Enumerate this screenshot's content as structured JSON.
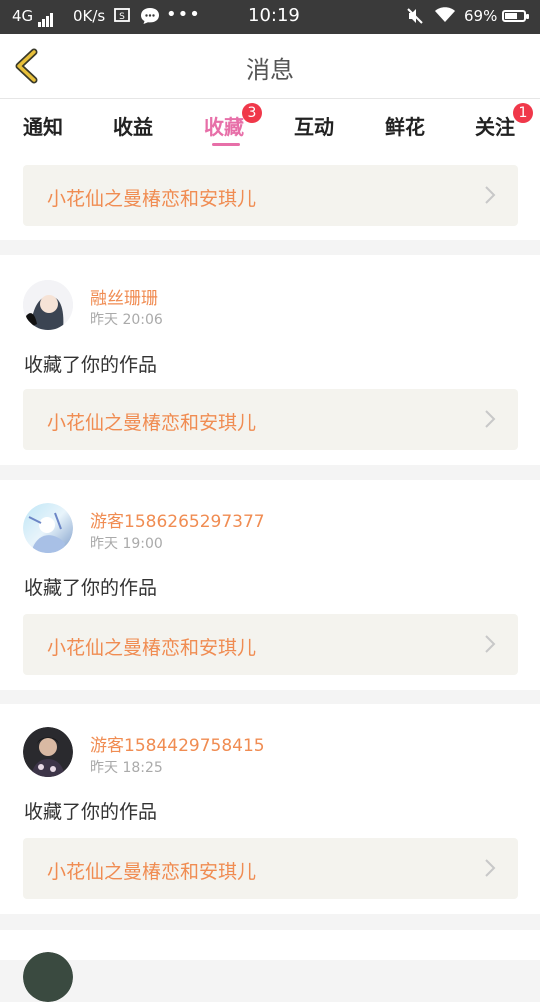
{
  "status_bar": {
    "network": "4G",
    "speed": "0K/s",
    "time": "10:19",
    "battery": "69%",
    "battery_level": 0.69
  },
  "header": {
    "title": "消息",
    "back_icon": "chevron-left-icon",
    "accent": "#e8c03a"
  },
  "tabs": [
    {
      "label": "通知"
    },
    {
      "label": "收益"
    },
    {
      "label": "收藏",
      "badge": "3",
      "active": true
    },
    {
      "label": "互动"
    },
    {
      "label": "鲜花"
    },
    {
      "label": "关注",
      "badge": "1"
    }
  ],
  "colors": {
    "active_tab": "#e76fa8",
    "username": "#f08c52",
    "badge": "#f0384a"
  },
  "first_card": {
    "work_title": "小花仙之曼椿恋和安琪儿"
  },
  "notifications": [
    {
      "username": "融丝珊珊",
      "time": "昨天 20:06",
      "action": "收藏了你的作品",
      "work_title": "小花仙之曼椿恋和安琪儿"
    },
    {
      "username": "游客1586265297377",
      "time": "昨天 19:00",
      "action": "收藏了你的作品",
      "work_title": "小花仙之曼椿恋和安琪儿"
    },
    {
      "username": "游客1584429758415",
      "time": "昨天 18:25",
      "action": "收藏了你的作品",
      "work_title": "小花仙之曼椿恋和安琪儿"
    }
  ]
}
